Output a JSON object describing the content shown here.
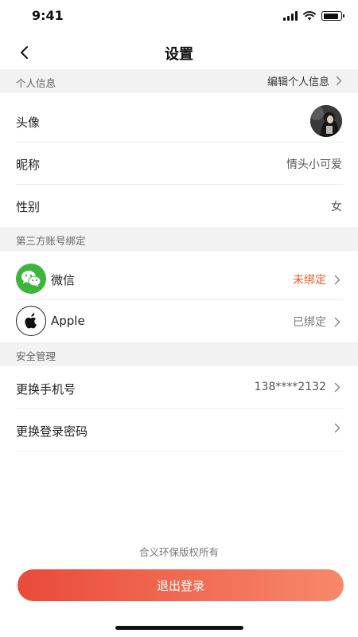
{
  "status_bar": {
    "time": "9:41",
    "battery_level": 0.9
  },
  "nav": {
    "title": "设置"
  },
  "personal_info": {
    "header": "个人信息",
    "edit_label": "编辑个人信息",
    "rows": {
      "avatar_label": "头像",
      "nickname_label": "昵称",
      "nickname_value": "情头小可爱",
      "gender_label": "性别",
      "gender_value": "女"
    }
  },
  "third_party": {
    "header": "第三方账号绑定",
    "wechat": {
      "label": "微信",
      "status": "未绑定",
      "status_color": "#f25a2a"
    },
    "apple": {
      "label": "Apple",
      "status": "已绑定"
    }
  },
  "security": {
    "header": "安全管理",
    "phone_label": "更换手机号",
    "phone_value": "138****2132",
    "password_label": "更换登录密码"
  },
  "footer": {
    "copyright": "合义环保版权所有"
  },
  "logout": {
    "label": "退出登录"
  },
  "colors": {
    "accent_start": "#ea4a3a",
    "accent_end": "#f7896a",
    "wechat_green": "#3cb53a"
  }
}
